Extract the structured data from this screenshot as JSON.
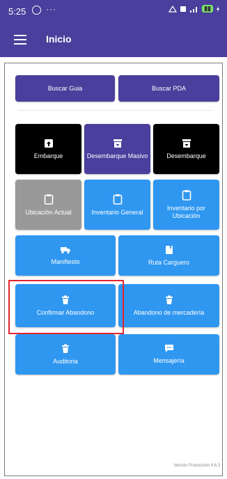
{
  "status_bar": {
    "time": "5:25",
    "dots": "···"
  },
  "app_bar": {
    "title": "Inicio"
  },
  "top_buttons": [
    {
      "label": "Buscar Guia"
    },
    {
      "label": "Buscar PDA"
    }
  ],
  "tiles": {
    "embarque": "Embarque",
    "desembarque_masivo": "Desembarque Masivo",
    "desembarque": "Desembarque",
    "ubicacion_actual": "Ubicación Actual",
    "inventario_general": "Inventario General",
    "inventario_por_ubicacion": "Inventario por Ubicación",
    "manifiesto": "Manifiesto",
    "ruta_carguero": "Ruta Carguero",
    "confirmar_abandono": "Confirmar Abandono",
    "abandono_mercaderia": "Abandono de mercadería",
    "auditoria": "Auditoria",
    "mensajeria": "Mensajería"
  },
  "footer": {
    "version": "Versión Producción 4.6.3"
  },
  "colors": {
    "primary": "#4a3f9c",
    "tile_blue": "#2f97f0",
    "tile_black": "#000000",
    "tile_gray": "#999999",
    "highlight": "#e3242b"
  },
  "icons": {
    "embarque": "box-up-icon",
    "desembarque_masivo": "archive-down-icon",
    "desembarque": "archive-down-icon",
    "clipboard": "clipboard-icon",
    "manifiesto": "truck-icon",
    "ruta_carguero": "book-icon",
    "trash": "trash-icon",
    "mensajeria": "chat-icon"
  }
}
